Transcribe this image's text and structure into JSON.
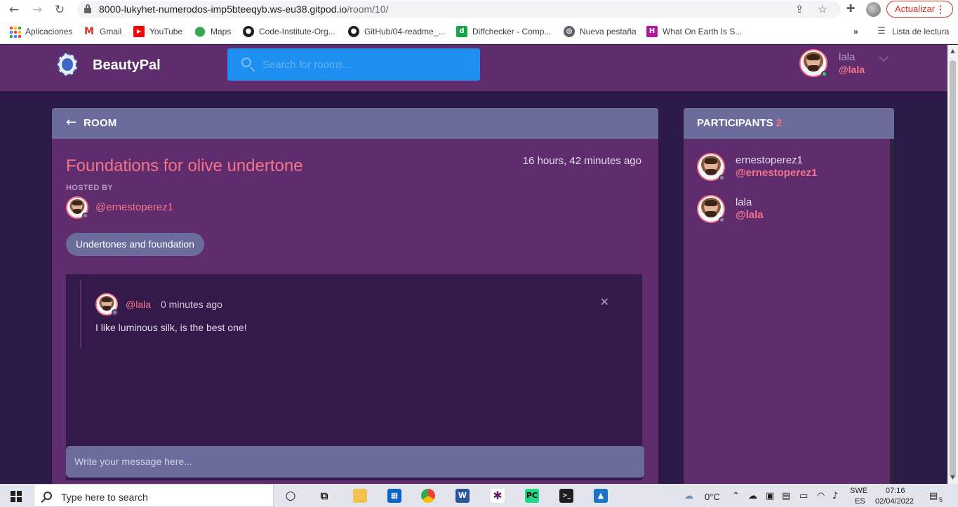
{
  "browser": {
    "url_host": "8000-lukyhet-numerodos-imp5bteeqyb.ws-eu38.gitpod.io",
    "url_path": "/room/10/",
    "update_label": "Actualizar",
    "bookmarks": [
      {
        "label": "Aplicaciones",
        "icon": "apps-icon"
      },
      {
        "label": "Gmail",
        "icon": "gmail-icon"
      },
      {
        "label": "YouTube",
        "icon": "youtube-icon"
      },
      {
        "label": "Maps",
        "icon": "maps-icon"
      },
      {
        "label": "Code-Institute-Org...",
        "icon": "github-icon"
      },
      {
        "label": "GitHub/04-readme_...",
        "icon": "github-icon"
      },
      {
        "label": "Diffchecker - Comp...",
        "icon": "diffchecker-icon"
      },
      {
        "label": "Nueva pestaña",
        "icon": "globe-icon"
      },
      {
        "label": "What On Earth Is S...",
        "icon": "h-icon"
      }
    ],
    "reading_list_label": "Lista de lectura"
  },
  "site": {
    "brand": "BeautyPal",
    "search_placeholder": "Search for rooms...",
    "user": {
      "name": "lala",
      "handle": "@lala"
    }
  },
  "room": {
    "header_label": "ROOM",
    "title": "Foundations for olive undertone",
    "created_ago": "16 hours, 42 minutes ago",
    "hosted_by_label": "HOSTED BY",
    "host_handle": "@ernestoperez1",
    "topic": "Undertones and foundation",
    "messages": [
      {
        "handle": "@lala",
        "time": "0 minutes ago",
        "body": "I like luminous silk, is the best one!"
      }
    ],
    "message_placeholder": "Write your message here..."
  },
  "participants": {
    "label": "PARTICIPANTS",
    "count": "2",
    "items": [
      {
        "name": "ernestoperez1",
        "handle": "@ernestoperez1"
      },
      {
        "name": "lala",
        "handle": "@lala"
      }
    ]
  },
  "taskbar": {
    "search_placeholder": "Type here to search",
    "weather": "0°C",
    "language_top": "SWE",
    "language_bottom": "ES",
    "time": "07:16",
    "date": "02/04/2022",
    "notifications": "5"
  },
  "colors": {
    "accent": "#f5748a",
    "header_bg": "#5f2d6e",
    "panel_bg": "#5f2d6e",
    "panel_head_bg": "#6c6c9c",
    "page_bg": "#2c1a48",
    "search_bg": "#1d8ff0"
  }
}
